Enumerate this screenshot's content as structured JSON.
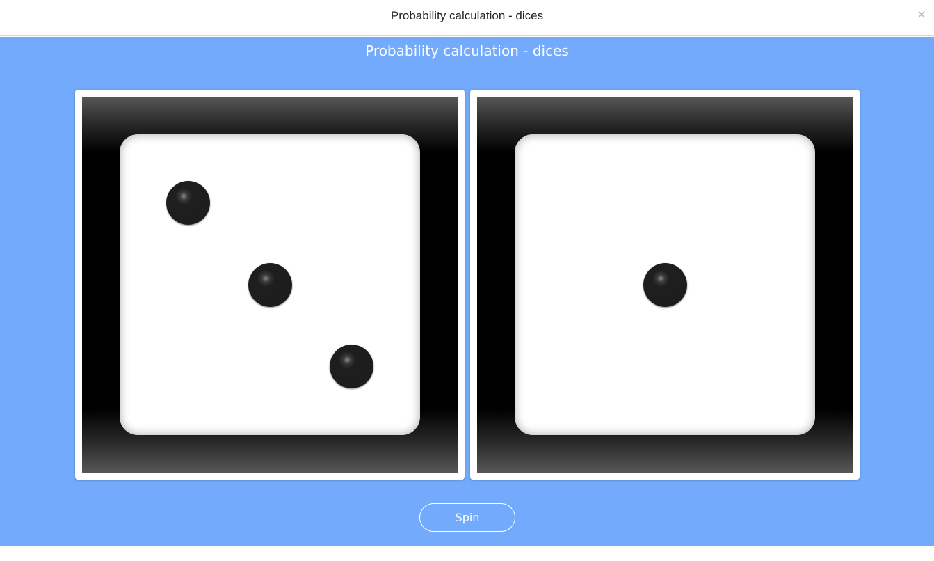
{
  "window": {
    "title": "Probability calculation - dices",
    "close_glyph": "×"
  },
  "app": {
    "title": "Probability calculation - dices",
    "background_color": "#73aafc"
  },
  "dice": [
    {
      "value": 3
    },
    {
      "value": 1
    }
  ],
  "controls": {
    "spin_label": "Spin"
  }
}
